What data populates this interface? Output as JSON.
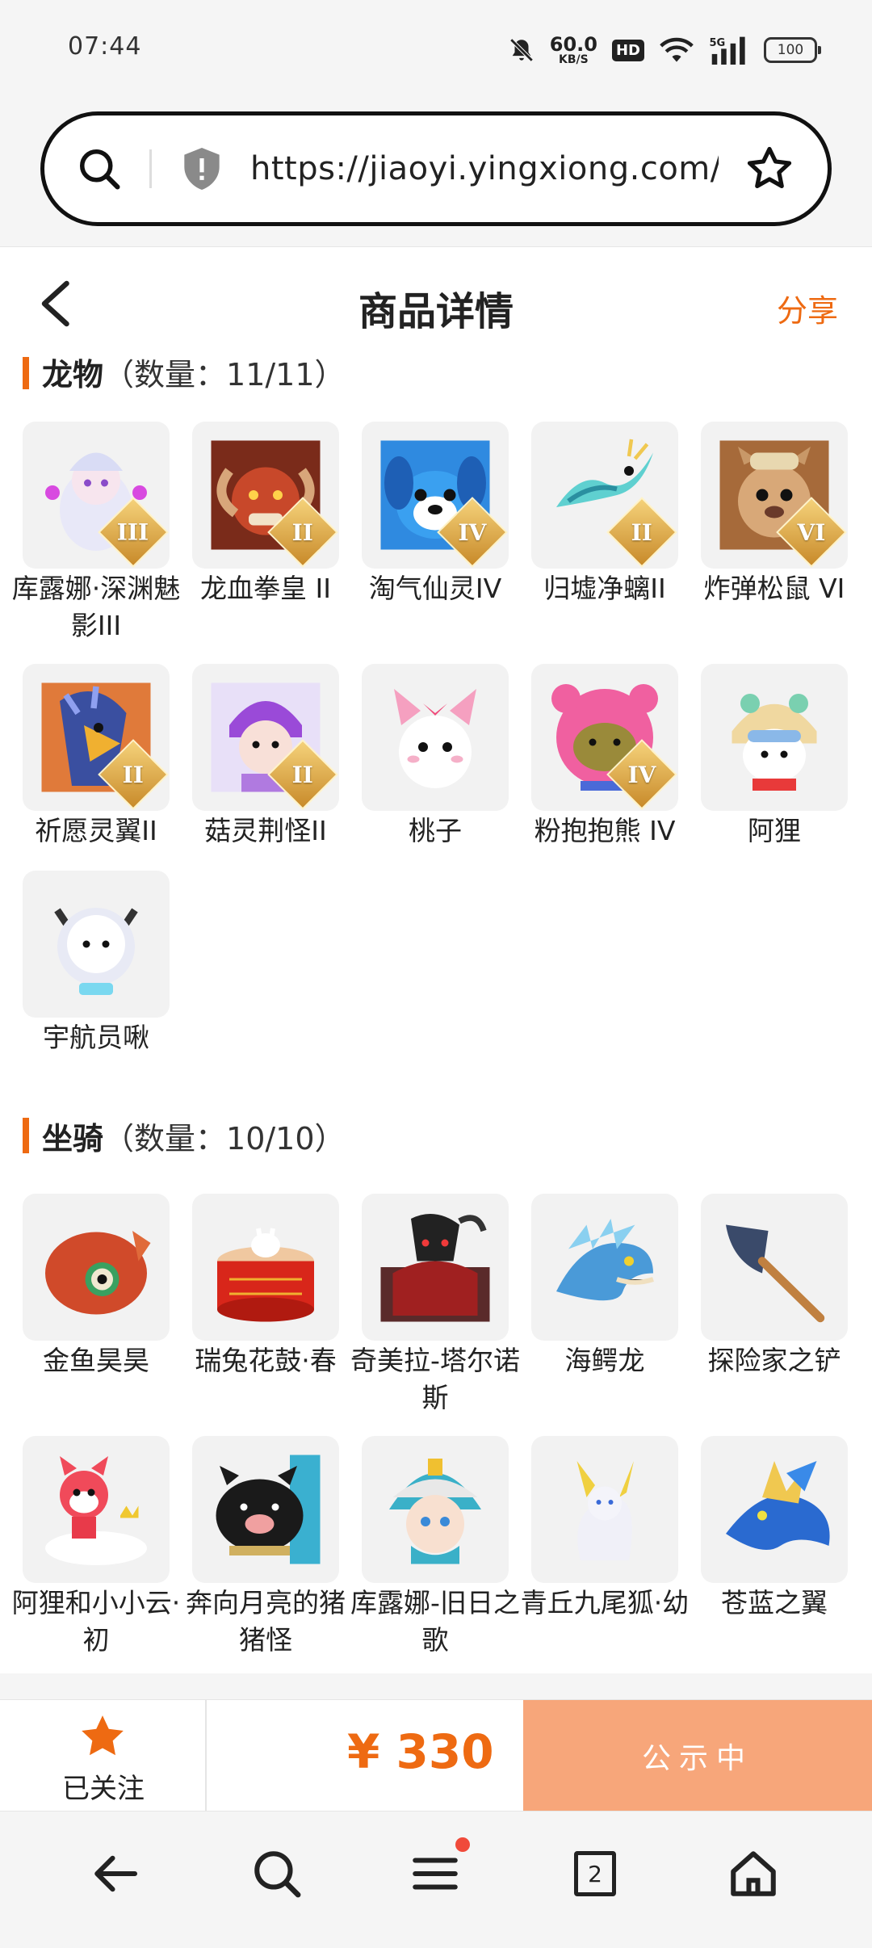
{
  "status_bar": {
    "time": "07:44",
    "net_speed_value": "60.0",
    "net_speed_unit": "KB/S",
    "hd": "HD",
    "battery": "100",
    "icons": [
      "mute-icon",
      "hd-icon",
      "wifi-icon",
      "signal-5g-icon",
      "battery-icon"
    ]
  },
  "browser": {
    "url": "https://jiaoyi.yingxiong.com/g ..."
  },
  "header": {
    "title": "商品详情",
    "share_label": "分享"
  },
  "sections": {
    "pets": {
      "name": "龙物",
      "count": "（数量：11/11）",
      "items": [
        {
          "name": "库露娜·深渊魅影III",
          "tier": "III"
        },
        {
          "name": "龙血拳皇 II",
          "tier": "II"
        },
        {
          "name": "淘气仙灵IV",
          "tier": "IV"
        },
        {
          "name": "归墟净螭II",
          "tier": "II"
        },
        {
          "name": "炸弹松鼠 VI",
          "tier": "VI"
        },
        {
          "name": "祈愿灵翼II",
          "tier": "II"
        },
        {
          "name": "菇灵荆怪II",
          "tier": "II"
        },
        {
          "name": "桃子",
          "tier": ""
        },
        {
          "name": "粉抱抱熊 IV",
          "tier": "IV"
        },
        {
          "name": "阿狸",
          "tier": ""
        },
        {
          "name": "宇航员啾",
          "tier": ""
        }
      ]
    },
    "mounts": {
      "name": "坐骑",
      "count": "（数量：10/10）",
      "items": [
        {
          "name": "金鱼昊昊"
        },
        {
          "name": "瑞兔花鼓·春"
        },
        {
          "name": "奇美拉-塔尔诺斯"
        },
        {
          "name": "海鳄龙"
        },
        {
          "name": "探险家之铲"
        },
        {
          "name": "阿狸和小小云·初"
        },
        {
          "name": "奔向月亮的猪猪怪"
        },
        {
          "name": "库露娜-旧日之歌"
        },
        {
          "name": "青丘九尾狐·幼"
        },
        {
          "name": "苍蓝之翼"
        }
      ]
    }
  },
  "action_bar": {
    "follow_label": "已关注",
    "price": "¥ 330",
    "status_label": "公示中"
  },
  "nav": {
    "tab_count": "2"
  },
  "colors": {
    "accent": "#ee6a12",
    "status_button": "#f7a67a"
  }
}
